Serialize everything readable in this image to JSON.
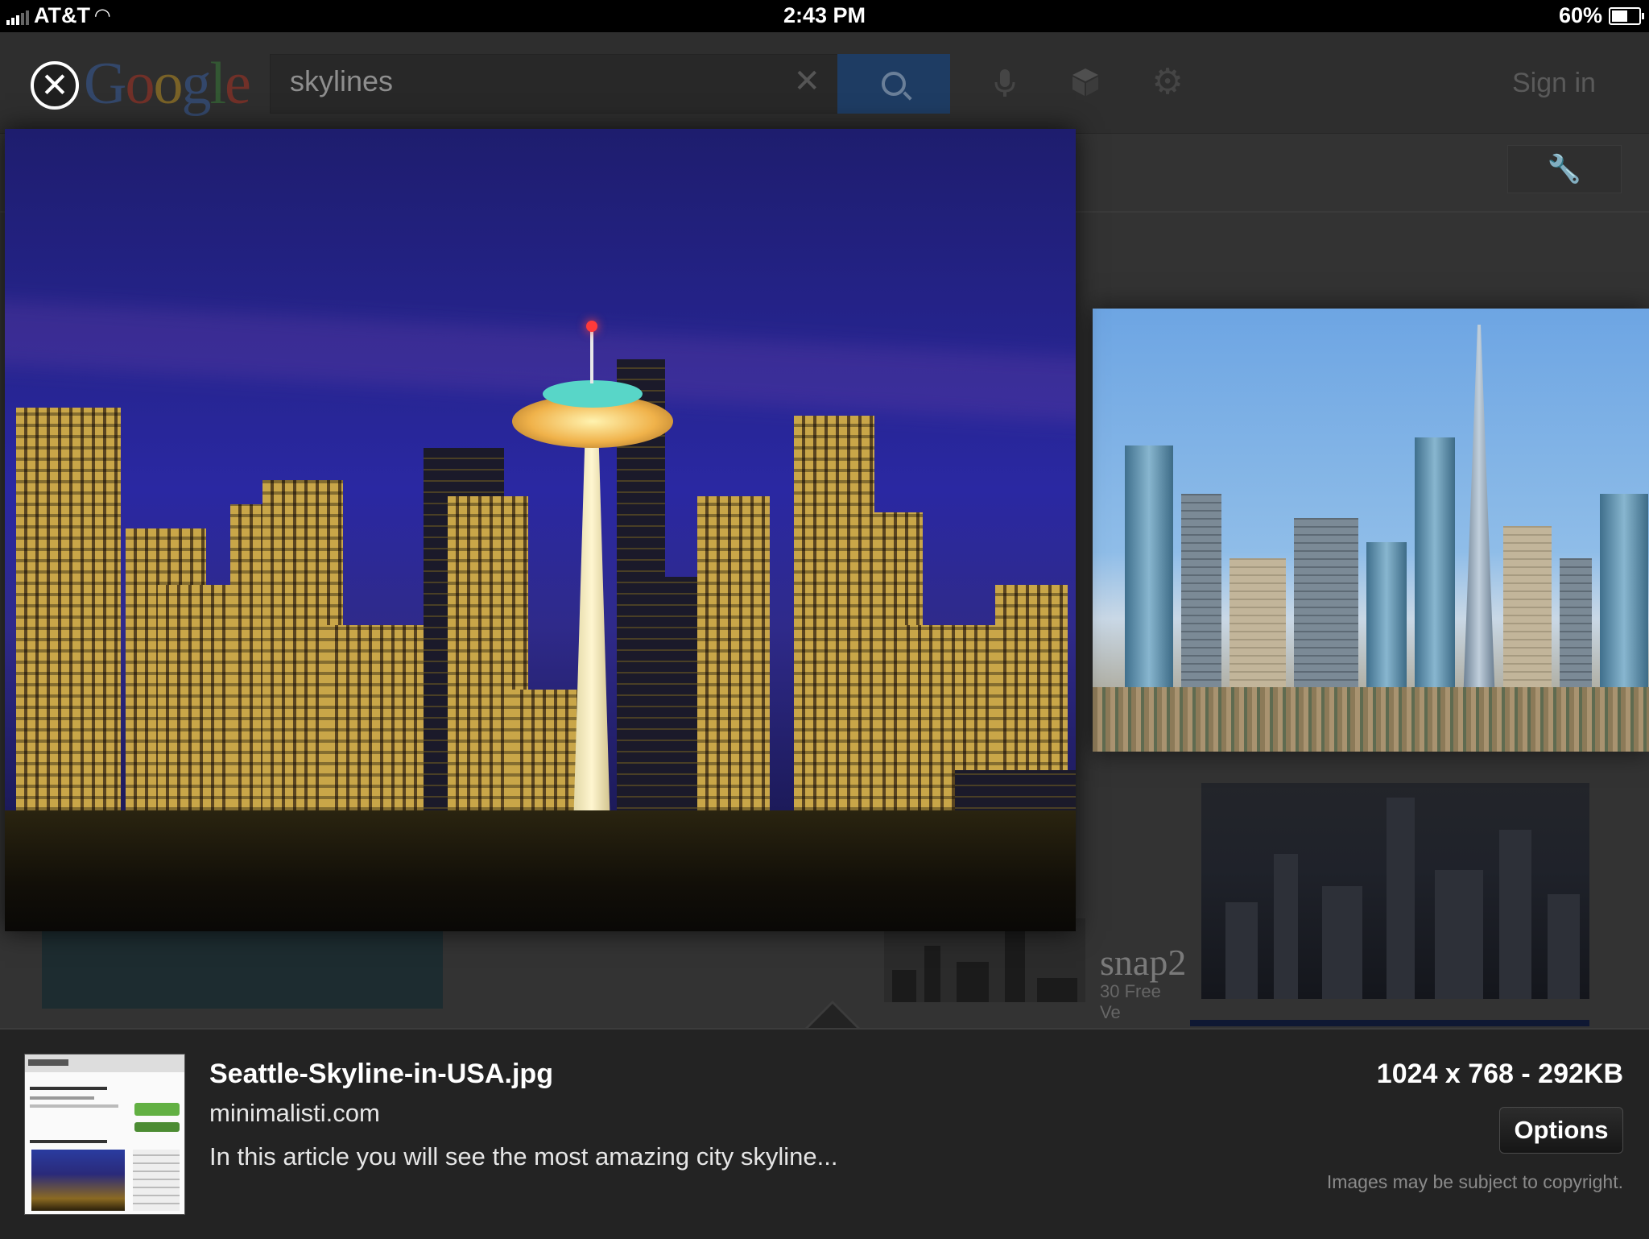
{
  "status_bar": {
    "carrier": "AT&T",
    "time": "2:43 PM",
    "battery": "60%",
    "battery_level": 0.6
  },
  "header": {
    "logo": "Google",
    "logo_letters": [
      "G",
      "o",
      "o",
      "g",
      "l",
      "e"
    ],
    "logo_colors": [
      "#3b67b3",
      "#c23321",
      "#d5a21f",
      "#3b67b3",
      "#3b8a3b",
      "#c23321"
    ],
    "search_query": "skylines",
    "sign_in": "Sign in",
    "accent": "#1e3c63"
  },
  "icons": {
    "close": "close-icon",
    "clear": "clear-icon",
    "search": "search-icon",
    "mic": "microphone-icon",
    "cube": "cube-icon",
    "settings": "gear-icon",
    "tools": "wrench-icon"
  },
  "background_results": {
    "snap_title": "snap2",
    "snap_subtitle": "30 Free Ve"
  },
  "image_details": {
    "file_name": "Seattle-Skyline-in-USA.jpg",
    "domain": "minimalisti.com",
    "description": "In this article you will see the most amazing city skyline...",
    "dimensions": "1024 x 768 - 292KB",
    "options_label": "Options",
    "copyright": "Images may be subject to copyright."
  }
}
